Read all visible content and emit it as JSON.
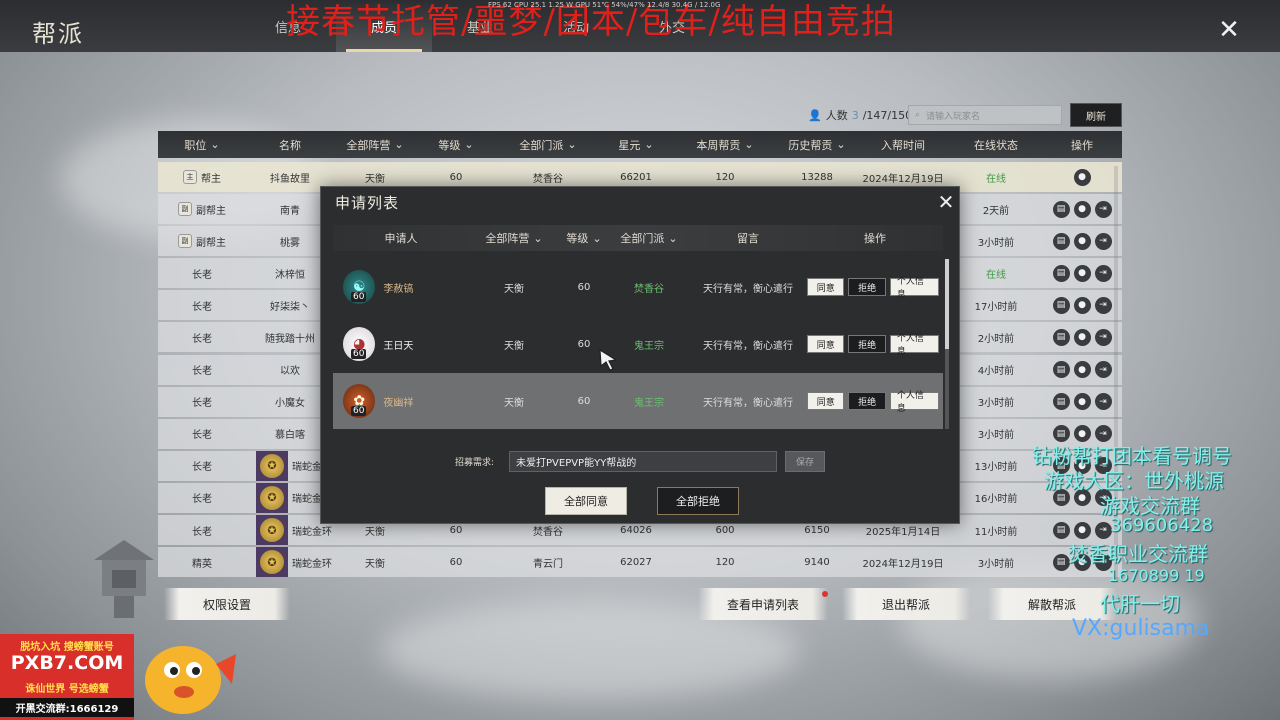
{
  "window": {
    "title": "帮派",
    "tabs": [
      {
        "label": "信息"
      },
      {
        "label": "成员",
        "active": true
      },
      {
        "label": "基业"
      },
      {
        "label": "活动"
      },
      {
        "label": "外交"
      }
    ],
    "overlay_banner": "接春节托管/噩梦/团本/包车/纯自由竞拍",
    "perf_bar": "FPS 62  CPU 25.1  1.25 W  GPU 51℃  54%/47%  12.4/8  30.4G / 12.0G",
    "close_icon": "close-icon"
  },
  "members": {
    "count_label": "人数",
    "online": "3",
    "count_rest": "/147/150",
    "search_placeholder": "请输入玩家名",
    "refresh_label": "刷新",
    "headers": [
      "职位",
      "名称",
      "全部阵营",
      "等级",
      "全部门派",
      "星元",
      "本周帮贡",
      "历史帮贡",
      "入帮时间",
      "在线状态",
      "操作"
    ],
    "rows": [
      {
        "pos": "帮主",
        "badge": "主",
        "name": "抖鱼故里",
        "camp": "天衡",
        "lvl": "60",
        "school": "焚香谷",
        "star": "66201",
        "week": "120",
        "hist": "13288",
        "join": "2024年12月19日",
        "online": "在线",
        "green": true,
        "ops": 1
      },
      {
        "pos": "副帮主",
        "badge": "副",
        "name": "南青",
        "camp": "",
        "lvl": "",
        "school": "",
        "star": "",
        "week": "",
        "hist": "",
        "join": "",
        "online": "2天前",
        "ops": 3
      },
      {
        "pos": "副帮主",
        "badge": "副",
        "name": "桃雾",
        "camp": "",
        "lvl": "",
        "school": "",
        "star": "",
        "week": "",
        "hist": "",
        "join": "",
        "online": "3小时前",
        "ops": 3
      },
      {
        "pos": "长老",
        "name": "沐梓恒",
        "camp": "",
        "lvl": "",
        "school": "",
        "star": "",
        "week": "",
        "hist": "",
        "join": "",
        "online": "在线",
        "green": true,
        "ops": 3
      },
      {
        "pos": "长老",
        "name": "好柒柒丶",
        "camp": "",
        "lvl": "",
        "school": "",
        "star": "",
        "week": "",
        "hist": "",
        "join": "",
        "online": "17小时前",
        "ops": 3
      },
      {
        "pos": "长老",
        "name": "随我踏十州",
        "camp": "",
        "lvl": "",
        "school": "",
        "star": "",
        "week": "",
        "hist": "",
        "join": "",
        "online": "2小时前",
        "ops": 3
      },
      {
        "pos": "长老",
        "name": "以欢",
        "camp": "",
        "lvl": "",
        "school": "",
        "star": "",
        "week": "",
        "hist": "",
        "join": "",
        "online": "4小时前",
        "ops": 3
      },
      {
        "pos": "长老",
        "name": "小魔女",
        "camp": "",
        "lvl": "",
        "school": "",
        "star": "",
        "week": "",
        "hist": "",
        "join": "",
        "online": "3小时前",
        "ops": 3
      },
      {
        "pos": "长老",
        "name": "慕白喀",
        "camp": "",
        "lvl": "",
        "school": "",
        "star": "",
        "week": "",
        "hist": "",
        "join": "",
        "online": "3小时前",
        "ops": 3
      },
      {
        "pos": "长老",
        "name": "瑞蛇金环",
        "avatar": true,
        "camp": "",
        "lvl": "",
        "school": "",
        "star": "",
        "week": "",
        "hist": "",
        "join": "",
        "online": "13小时前",
        "ops": 3
      },
      {
        "pos": "长老",
        "name": "瑞蛇金环",
        "avatar": true,
        "camp": "",
        "lvl": "",
        "school": "",
        "star": "",
        "week": "",
        "hist": "",
        "join": "",
        "online": "16小时前",
        "ops": 3
      },
      {
        "pos": "长老",
        "name": "瑞蛇金环",
        "avatar": true,
        "camp": "天衡",
        "lvl": "60",
        "school": "焚香谷",
        "star": "64026",
        "week": "600",
        "hist": "6150",
        "join": "2025年1月14日",
        "online": "11小时前",
        "ops": 3
      },
      {
        "pos": "精英",
        "name": "瑞蛇金环",
        "avatar": true,
        "camp": "天衡",
        "lvl": "60",
        "school": "青云门",
        "star": "62027",
        "week": "120",
        "hist": "9140",
        "join": "2024年12月19日",
        "online": "3小时前",
        "ops": 3
      }
    ]
  },
  "bottom_buttons": {
    "permissions": "权限设置",
    "view_applications": "查看申请列表",
    "leave": "退出帮派",
    "disband": "解散帮派"
  },
  "modal": {
    "title": "申请列表",
    "headers": {
      "applicant": "申请人",
      "camp": "全部阵营",
      "lvl": "等级",
      "school": "全部门派",
      "msg": "留言",
      "ops": "操作"
    },
    "applicants": [
      {
        "name": "李赦镐",
        "level_badge": "60",
        "camp": "天衡",
        "lvl": "60",
        "school": "焚香谷",
        "msg": "天行有常，衡心遣行"
      },
      {
        "name": "王日天",
        "level_badge": "60",
        "camp": "天衡",
        "lvl": "60",
        "school": "鬼王宗",
        "msg": "天行有常，衡心遣行"
      },
      {
        "name": "夜幽祥",
        "level_badge": "60",
        "camp": "天衡",
        "lvl": "60",
        "school": "鬼王宗",
        "msg": "天行有常，衡心遣行"
      }
    ],
    "agree_label": "同意",
    "reject_label": "拒绝",
    "info_label": "个人信息",
    "recruit_label": "招募需求:",
    "recruit_value": "未爱打PVEPVP能YY帮战的",
    "save_label": "保存",
    "agree_all": "全部同意",
    "reject_all": "全部拒绝"
  },
  "stream_overlay": {
    "lines": [
      "钻粉帮打团本看号调号",
      "游戏大区：世外桃源",
      "游戏交流群",
      "369606428",
      "焚香职业交流群",
      "1670899 19",
      "代肝一切",
      "VX:gulisama"
    ],
    "logo_top": "脱坑入坑 搜螃蟹账号",
    "logo_brand": "PXB7.COM",
    "logo_game": "诛仙世界 号选螃蟹",
    "logo_group": "开黑交流群:1666129"
  }
}
